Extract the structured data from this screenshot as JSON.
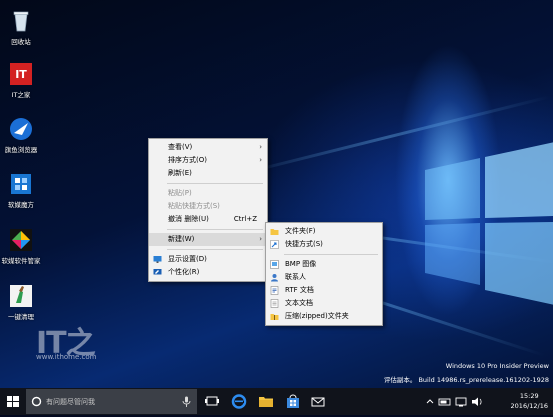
{
  "desktop": {
    "icons": [
      {
        "label": "回收站",
        "icon": "recycle-bin-icon"
      },
      {
        "label": "IT之家",
        "icon": "ithome-icon"
      },
      {
        "label": "旗鱼浏览器",
        "icon": "qiyu-browser-icon"
      },
      {
        "label": "软媒魔方",
        "icon": "ruanmei-cube-icon"
      },
      {
        "label": "软媒软件管家",
        "icon": "software-manager-icon"
      },
      {
        "label": "一键清理",
        "icon": "one-click-clean-icon"
      }
    ],
    "watermark": {
      "line1": "Windows 10 Pro Insider Preview",
      "line2": "评估副本。 Build 14986.rs_prerelease.161202-1928"
    },
    "site_logo": "IT之",
    "site_url": "www.ithome.com"
  },
  "context_menu": {
    "items": [
      {
        "label": "查看(V)"
      },
      {
        "label": "排序方式(O)"
      },
      {
        "label": "刷新(E)"
      },
      {
        "label": "粘贴(P)"
      },
      {
        "label": "粘贴快捷方式(S)"
      },
      {
        "label": "撤消 删除(U)",
        "shortcut": "Ctrl+Z"
      },
      {
        "label": "新建(W)"
      },
      {
        "label": "显示设置(D)"
      },
      {
        "label": "个性化(R)"
      }
    ]
  },
  "submenu": {
    "items": [
      {
        "label": "文件夹(F)"
      },
      {
        "label": "快捷方式(S)"
      },
      {
        "label": "BMP 图像"
      },
      {
        "label": "联系人"
      },
      {
        "label": "RTF 文档"
      },
      {
        "label": "文本文档"
      },
      {
        "label": "压缩(zipped)文件夹"
      }
    ]
  },
  "taskbar": {
    "search_placeholder": "有问题尽管问我",
    "time": "15:29",
    "date": "2016/12/16"
  }
}
